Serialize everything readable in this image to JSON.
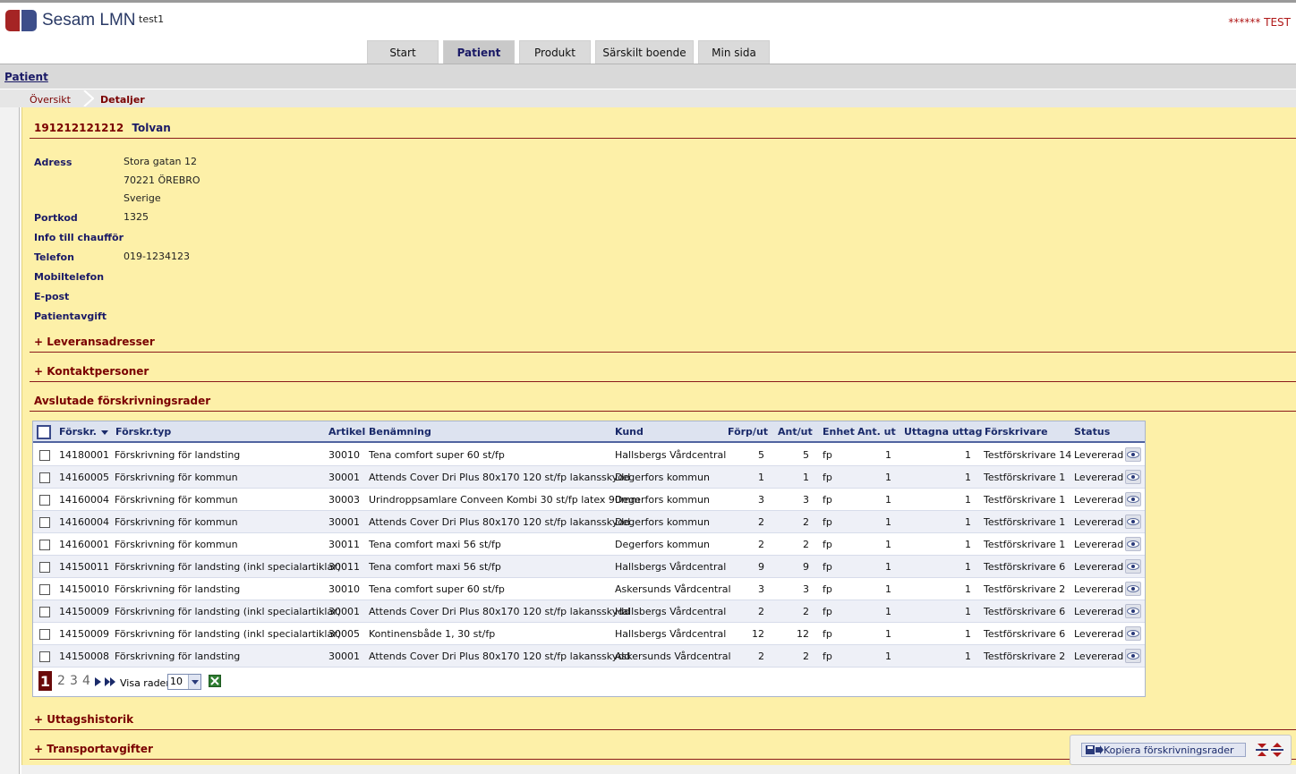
{
  "app": {
    "name": "Sesam LMN",
    "user": "test1",
    "environment": "****** TEST"
  },
  "tabs": [
    {
      "label": "Start",
      "active": false
    },
    {
      "label": "Patient",
      "active": true
    },
    {
      "label": "Produkt",
      "active": false
    },
    {
      "label": "Särskilt boende",
      "active": false
    },
    {
      "label": "Min sida",
      "active": false
    }
  ],
  "subnav": {
    "link": "Patient"
  },
  "breadcrumb": {
    "first": "Översikt",
    "current": "Detaljer"
  },
  "patient": {
    "id": "191212121212",
    "name": "Tolvan",
    "fields": {
      "adress_label": "Adress",
      "adress_line1": "Stora gatan 12",
      "adress_line2": "70221 ÖREBRO",
      "adress_line3": "Sverige",
      "portkod_label": "Portkod",
      "portkod_value": "1325",
      "chauffor_label": "Info till chaufför",
      "telefon_label": "Telefon",
      "telefon_value": "019-1234123",
      "mobil_label": "Mobiltelefon",
      "epost_label": "E-post",
      "avgift_label": "Patientavgift"
    }
  },
  "sections": {
    "leveransadresser": "+ Leveransadresser",
    "kontaktpersoner": "+ Kontaktpersoner",
    "avslutade": "Avslutade förskrivningsrader",
    "uttagshistorik": "+ Uttagshistorik",
    "transportavgifter": "+ Transportavgifter"
  },
  "grid": {
    "headers": {
      "forskr": "Förskr.",
      "typ": "Förskr.typ",
      "artikel": "Artikel",
      "benamning": "Benämning",
      "kund": "Kund",
      "forp": "Förp/ut",
      "ant": "Ant/ut",
      "enhet": "Enhet",
      "antut": "Ant. ut",
      "uttagna": "Uttagna uttag",
      "forskrivare": "Förskrivare",
      "status": "Status"
    },
    "rows": [
      {
        "forskr": "14180001",
        "typ": "Förskrivning för landsting",
        "artikel": "30010",
        "benamning": "Tena comfort super 60 st/fp",
        "kund": "Hallsbergs Vårdcentral",
        "forp": "5",
        "ant": "5",
        "enhet": "fp",
        "antut": "1",
        "uttagna": "1",
        "forskrivare": "Testförskrivare 14",
        "status": "Levererad"
      },
      {
        "forskr": "14160005",
        "typ": "Förskrivning för kommun",
        "artikel": "30001",
        "benamning": "Attends Cover Dri Plus 80x170 120 st/fp lakansskydd",
        "kund": "Degerfors kommun",
        "forp": "1",
        "ant": "1",
        "enhet": "fp",
        "antut": "1",
        "uttagna": "1",
        "forskrivare": "Testförskrivare 1",
        "status": "Levererad"
      },
      {
        "forskr": "14160004",
        "typ": "Förskrivning för kommun",
        "artikel": "30003",
        "benamning": "Urindroppsamlare Conveen Kombi 30 st/fp latex 90mm",
        "kund": "Degerfors kommun",
        "forp": "3",
        "ant": "3",
        "enhet": "fp",
        "antut": "1",
        "uttagna": "1",
        "forskrivare": "Testförskrivare 1",
        "status": "Levererad"
      },
      {
        "forskr": "14160004",
        "typ": "Förskrivning för kommun",
        "artikel": "30001",
        "benamning": "Attends Cover Dri Plus 80x170 120 st/fp lakansskydd",
        "kund": "Degerfors kommun",
        "forp": "2",
        "ant": "2",
        "enhet": "fp",
        "antut": "1",
        "uttagna": "1",
        "forskrivare": "Testförskrivare 1",
        "status": "Levererad"
      },
      {
        "forskr": "14160001",
        "typ": "Förskrivning för kommun",
        "artikel": "30011",
        "benamning": "Tena comfort maxi 56 st/fp",
        "kund": "Degerfors kommun",
        "forp": "2",
        "ant": "2",
        "enhet": "fp",
        "antut": "1",
        "uttagna": "1",
        "forskrivare": "Testförskrivare 1",
        "status": "Levererad"
      },
      {
        "forskr": "14150011",
        "typ": "Förskrivning för landsting (inkl specialartiklar)",
        "artikel": "30011",
        "benamning": "Tena comfort maxi 56 st/fp",
        "kund": "Hallsbergs Vårdcentral",
        "forp": "9",
        "ant": "9",
        "enhet": "fp",
        "antut": "1",
        "uttagna": "1",
        "forskrivare": "Testförskrivare 6",
        "status": "Levererad"
      },
      {
        "forskr": "14150010",
        "typ": "Förskrivning för landsting",
        "artikel": "30010",
        "benamning": "Tena comfort super 60 st/fp",
        "kund": "Askersunds Vårdcentral",
        "forp": "3",
        "ant": "3",
        "enhet": "fp",
        "antut": "1",
        "uttagna": "1",
        "forskrivare": "Testförskrivare 2",
        "status": "Levererad"
      },
      {
        "forskr": "14150009",
        "typ": "Förskrivning för landsting (inkl specialartiklar)",
        "artikel": "30001",
        "benamning": "Attends Cover Dri Plus 80x170 120 st/fp lakansskydd",
        "kund": "Hallsbergs Vårdcentral",
        "forp": "2",
        "ant": "2",
        "enhet": "fp",
        "antut": "1",
        "uttagna": "1",
        "forskrivare": "Testförskrivare 6",
        "status": "Levererad"
      },
      {
        "forskr": "14150009",
        "typ": "Förskrivning för landsting (inkl specialartiklar)",
        "artikel": "30005",
        "benamning": "Kontinensbåde 1, 30 st/fp",
        "kund": "Hallsbergs Vårdcentral",
        "forp": "12",
        "ant": "12",
        "enhet": "fp",
        "antut": "1",
        "uttagna": "1",
        "forskrivare": "Testförskrivare 6",
        "status": "Levererad"
      },
      {
        "forskr": "14150008",
        "typ": "Förskrivning för landsting",
        "artikel": "30001",
        "benamning": "Attends Cover Dri Plus 80x170 120 st/fp lakansskydd",
        "kund": "Askersunds Vårdcentral",
        "forp": "2",
        "ant": "2",
        "enhet": "fp",
        "antut": "1",
        "uttagna": "1",
        "forskrivare": "Testförskrivare 2",
        "status": "Levererad"
      }
    ],
    "pager": {
      "current": "1",
      "pages": [
        "2",
        "3",
        "4"
      ],
      "rows_label": "Visa rader",
      "rows_value": "10"
    }
  },
  "copy_button": "Kopiera förskrivningsrader",
  "colors": {
    "content_bg": "#fdf0a8",
    "accent_red": "#7a0000",
    "accent_blue": "#1a1a66"
  }
}
